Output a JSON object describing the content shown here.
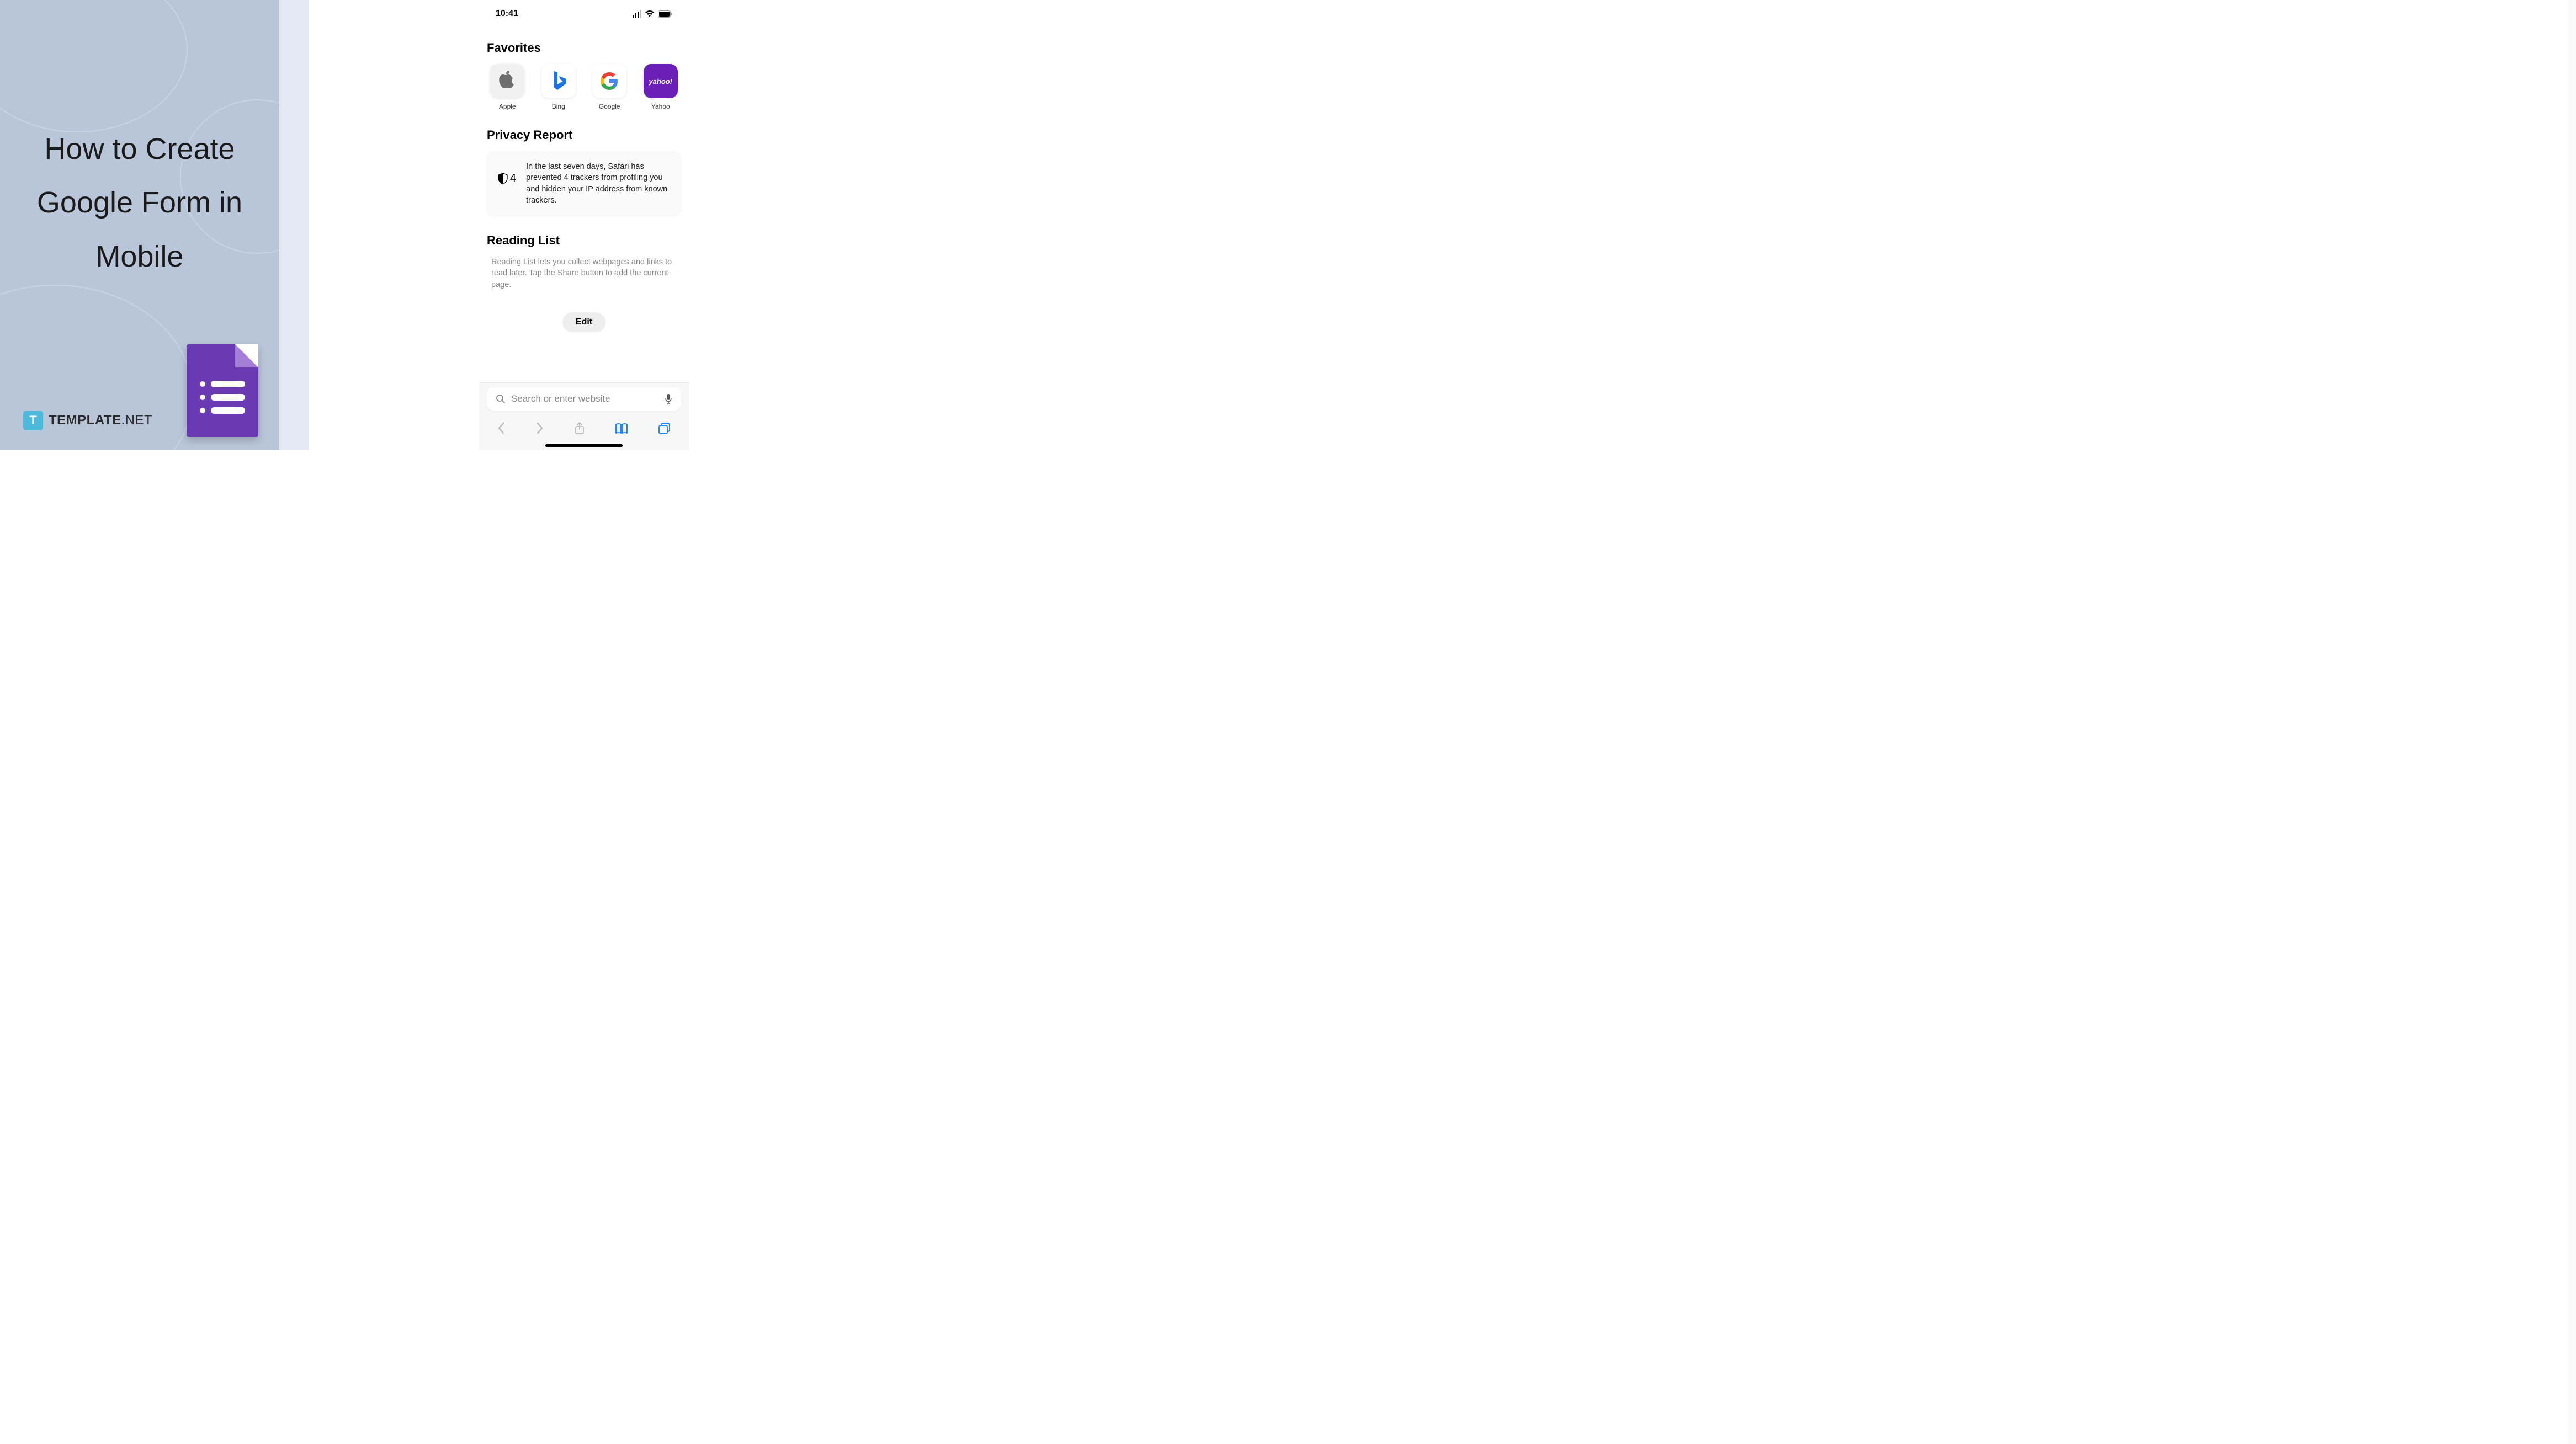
{
  "left": {
    "title": "How to Create Google Form in Mobile",
    "brand": "TEMPLATE",
    "brand_suffix": ".NET"
  },
  "phone": {
    "status": {
      "time": "10:41"
    },
    "favorites": {
      "heading": "Favorites",
      "items": [
        {
          "label": "Apple"
        },
        {
          "label": "Bing"
        },
        {
          "label": "Google"
        },
        {
          "label": "Yahoo"
        }
      ]
    },
    "privacy": {
      "heading": "Privacy Report",
      "count": "4",
      "text": "In the last seven days, Safari has prevented 4 trackers from profiling you and hidden your IP address from known trackers."
    },
    "reading": {
      "heading": "Reading List",
      "text": "Reading List lets you collect webpages and links to read later. Tap the Share button to add the current page."
    },
    "edit_label": "Edit",
    "search": {
      "placeholder": "Search or enter website"
    },
    "yahoo_text": "yahoo!"
  }
}
